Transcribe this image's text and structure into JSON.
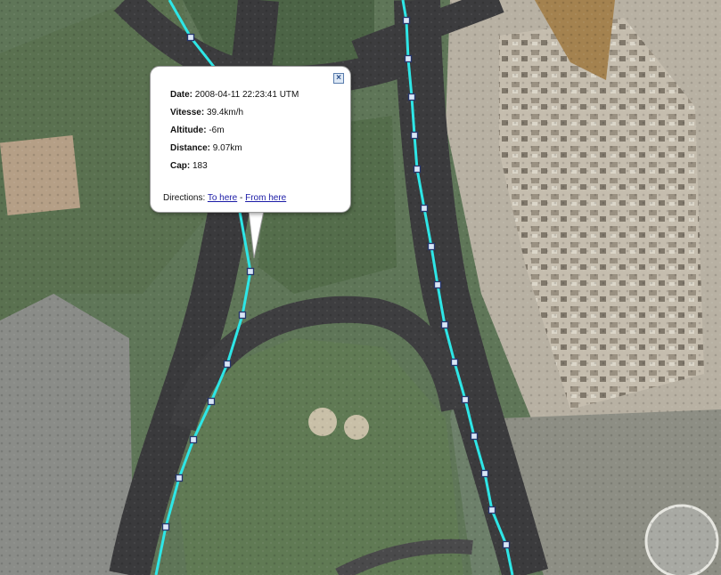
{
  "popup": {
    "close_icon": "close-icon",
    "fields": [
      {
        "key": "Date:",
        "value": "2008-04-11 22:23:41 UTM"
      },
      {
        "key": "Vitesse:",
        "value": "39.4km/h"
      },
      {
        "key": "Altitude:",
        "value": "-6m"
      },
      {
        "key": "Distance:",
        "value": "9.07km"
      },
      {
        "key": "Cap:",
        "value": "183"
      }
    ],
    "directions": {
      "label": "Directions:",
      "to_here": "To here",
      "separator": " - ",
      "from_here": "From here"
    }
  },
  "map": {
    "track_color": "#2ee6e6",
    "waypoint_icon": "square-waypoint-marker",
    "road_color": "#3c3c3e",
    "vegetation_color": "#5d7552",
    "construction_color": "#b9b2a4"
  }
}
